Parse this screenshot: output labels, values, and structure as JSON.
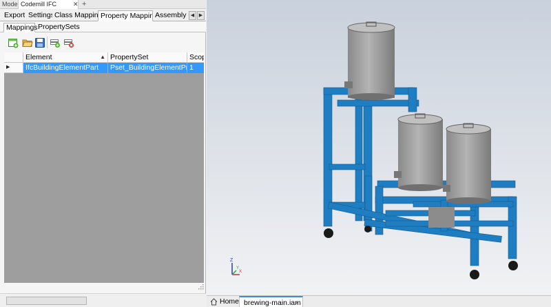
{
  "window": {
    "model_tab": "Model",
    "exporter_tab": "Codemill IFC Exporter",
    "close_glyph": "✕",
    "add_glyph": "+"
  },
  "tabs": [
    "Export",
    "Settings",
    "Class Mappings",
    "Property Mappings",
    "Assembly Co"
  ],
  "tab_arrows": {
    "left": "◀",
    "right": "▶"
  },
  "subtabs": [
    "Mappings",
    "PropertySets"
  ],
  "toolbar": {
    "icons": [
      "new-mapping-icon",
      "open-folder-icon",
      "save-icon",
      "add-row-icon",
      "delete-row-icon"
    ]
  },
  "grid": {
    "headers": {
      "element": "Element",
      "propertyset": "PropertySet",
      "scope": "Scope"
    },
    "sort_glyph": "▲",
    "row_marker": "▶",
    "rows": [
      {
        "element": "IfcBuildingElementPart",
        "propertyset": "Pset_BuildingElementProxy...",
        "scope": "1"
      }
    ],
    "selection_color": "#3399ff"
  },
  "viewport": {
    "frame_color": "#1f7ec2",
    "kettle_color": "#999999",
    "triad": {
      "z": "Z",
      "x": "X",
      "y": "Y"
    }
  },
  "bottom": {
    "home": "Home",
    "document": "brewing-main.iam",
    "close_glyph": "×"
  }
}
